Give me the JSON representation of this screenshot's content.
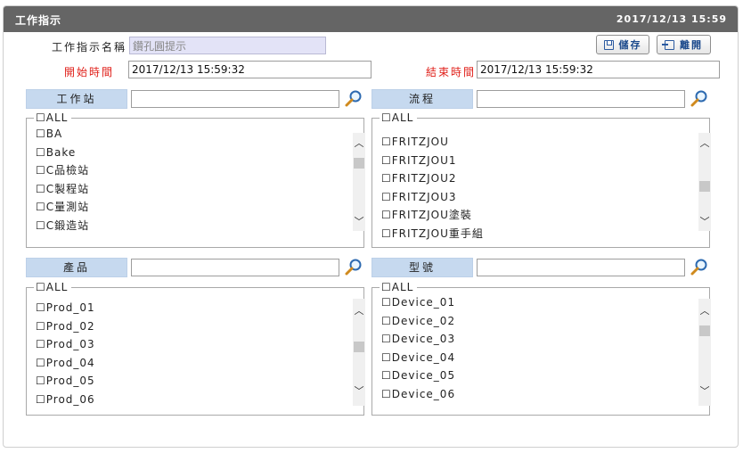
{
  "header": {
    "title": "工作指示",
    "datetime": "2017/12/13 15:59"
  },
  "form": {
    "name_label": "工作指示名稱",
    "name_value": "鑽孔圓提示",
    "start_label": "開始時間",
    "start_value": "2017/12/13 15:59:32",
    "end_label": "結束時間",
    "end_value": "2017/12/13 15:59:32"
  },
  "buttons": {
    "save": "儲存",
    "exit": "離開"
  },
  "colors": {
    "titlebar": "#656565",
    "section_header": "#c6d9ef",
    "required_label": "#e0201a",
    "button_text": "#1c4a8c"
  },
  "sections": {
    "station": {
      "title": "工作站",
      "search_value": "",
      "all_label": "ALL",
      "items": [
        "BA",
        "Bake",
        "C品檢站",
        "C製程站",
        "C量測站",
        "C鍛造站"
      ]
    },
    "process": {
      "title": "流程",
      "search_value": "",
      "all_label": "ALL",
      "items": [
        "FRITZJOU",
        "FRITZJOU1",
        "FRITZJOU2",
        "FRITZJOU3",
        "FRITZJOU塗裝",
        "FRITZJOU重手組"
      ]
    },
    "product": {
      "title": "產品",
      "search_value": "",
      "all_label": "ALL",
      "items": [
        "Prod_01",
        "Prod_02",
        "Prod_03",
        "Prod_04",
        "Prod_05",
        "Prod_06"
      ]
    },
    "model": {
      "title": "型號",
      "search_value": "",
      "all_label": "ALL",
      "items": [
        "Device_01",
        "Device_02",
        "Device_03",
        "Device_04",
        "Device_05",
        "Device_06"
      ]
    }
  },
  "icons": {
    "search": "magnifier-icon",
    "save": "floppy-icon",
    "exit": "exit-icon",
    "scroll_up": "chevron-up-icon",
    "scroll_down": "chevron-down-icon"
  },
  "checkbox_glyph": "☐"
}
